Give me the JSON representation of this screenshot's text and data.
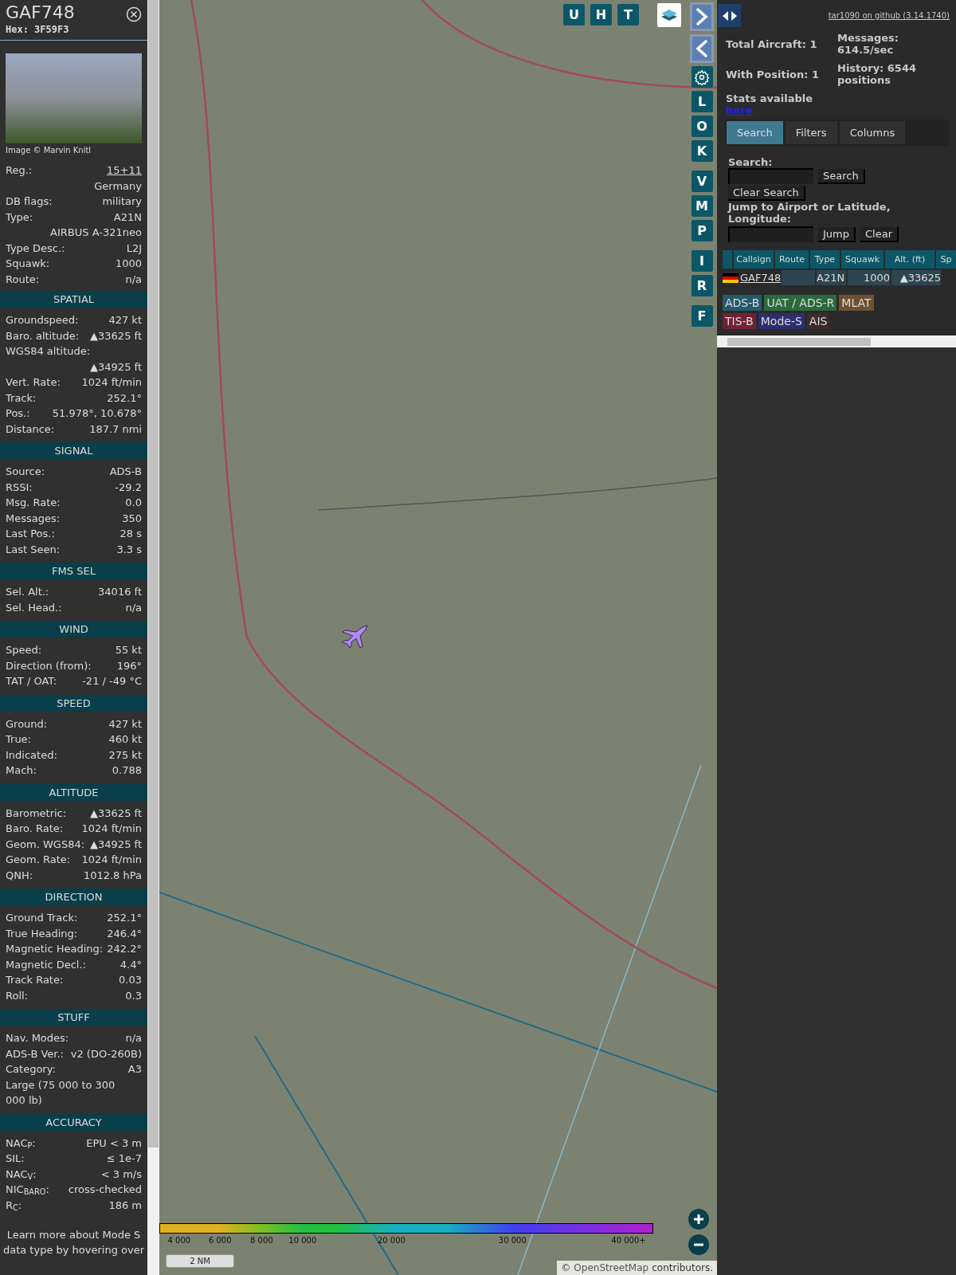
{
  "sidebar": {
    "callsign": "GAF748",
    "hex": "Hex: 3F59F3",
    "photo_credit": "Image © Marvin Knitl",
    "rows": [
      {
        "kind": "pair",
        "label": "Reg.:",
        "value": "15+11",
        "link": true
      },
      {
        "kind": "value",
        "value": "Germany"
      },
      {
        "kind": "pair",
        "label": "DB flags:",
        "value": "military"
      },
      {
        "kind": "pair",
        "label": "Type:",
        "value": "A21N"
      },
      {
        "kind": "value",
        "value": "AIRBUS A-321neo"
      },
      {
        "kind": "pair",
        "label": "Type Desc.:",
        "value": "L2J"
      },
      {
        "kind": "pair",
        "label": "Squawk:",
        "value": "1000"
      },
      {
        "kind": "pair",
        "label": "Route:",
        "value": "n/a"
      }
    ],
    "sections": [
      {
        "title": "SPATIAL",
        "rows": [
          {
            "kind": "pair",
            "label": "Groundspeed:",
            "value": "427 kt"
          },
          {
            "kind": "pair",
            "label": "Baro. altitude:",
            "value": "▲33625 ft"
          },
          {
            "kind": "label",
            "label": "WGS84 altitude:"
          },
          {
            "kind": "value",
            "value": "▲34925 ft"
          },
          {
            "kind": "pair",
            "label": "Vert. Rate:",
            "value": "1024 ft/min"
          },
          {
            "kind": "pair",
            "label": "Track:",
            "value": "252.1°"
          },
          {
            "kind": "pair",
            "label": "Pos.:",
            "value": "51.978°, 10.678°"
          },
          {
            "kind": "pair",
            "label": "Distance:",
            "value": "187.7 nmi"
          }
        ]
      },
      {
        "title": "SIGNAL",
        "rows": [
          {
            "kind": "pair",
            "label": "Source:",
            "value": "ADS-B"
          },
          {
            "kind": "pair",
            "label": "RSSI:",
            "value": "-29.2"
          },
          {
            "kind": "pair",
            "label": "Msg. Rate:",
            "value": "0.0"
          },
          {
            "kind": "pair",
            "label": "Messages:",
            "value": "350"
          },
          {
            "kind": "pair",
            "label": "Last Pos.:",
            "value": "28 s"
          },
          {
            "kind": "pair",
            "label": "Last Seen:",
            "value": "3.3 s"
          }
        ]
      },
      {
        "title": "FMS SEL",
        "rows": [
          {
            "kind": "pair",
            "label": "Sel. Alt.:",
            "value": "34016 ft"
          },
          {
            "kind": "pair",
            "label": "Sel. Head.:",
            "value": "n/a"
          }
        ]
      },
      {
        "title": "WIND",
        "rows": [
          {
            "kind": "pair",
            "label": "Speed:",
            "value": "55 kt"
          },
          {
            "kind": "pair",
            "label": "Direction (from):",
            "value": "196°"
          },
          {
            "kind": "pair",
            "label": "TAT / OAT:",
            "value": "-21 / -49 °C"
          }
        ]
      },
      {
        "title": "SPEED",
        "rows": [
          {
            "kind": "pair",
            "label": "Ground:",
            "value": "427 kt"
          },
          {
            "kind": "pair",
            "label": "True:",
            "value": "460 kt"
          },
          {
            "kind": "pair",
            "label": "Indicated:",
            "value": "275 kt"
          },
          {
            "kind": "pair",
            "label": "Mach:",
            "value": "0.788"
          }
        ]
      },
      {
        "title": "ALTITUDE",
        "rows": [
          {
            "kind": "pair",
            "label": "Barometric:",
            "value": "▲33625 ft"
          },
          {
            "kind": "pair",
            "label": "Baro. Rate:",
            "value": "1024 ft/min"
          },
          {
            "kind": "pair",
            "label": "Geom. WGS84:",
            "value": "▲34925 ft"
          },
          {
            "kind": "pair",
            "label": "Geom. Rate:",
            "value": "1024 ft/min"
          },
          {
            "kind": "pair",
            "label": "QNH:",
            "value": "1012.8 hPa"
          }
        ]
      },
      {
        "title": "DIRECTION",
        "rows": [
          {
            "kind": "pair",
            "label": "Ground Track:",
            "value": "252.1°"
          },
          {
            "kind": "pair",
            "label": "True Heading:",
            "value": "246.4°"
          },
          {
            "kind": "pair",
            "label": "Magnetic Heading:",
            "value": "242.2°"
          },
          {
            "kind": "pair",
            "label": "Magnetic Decl.:",
            "value": "4.4°"
          },
          {
            "kind": "pair",
            "label": "Track Rate:",
            "value": "0.03"
          },
          {
            "kind": "pair",
            "label": "Roll:",
            "value": "0.3"
          }
        ]
      },
      {
        "title": "STUFF",
        "rows": [
          {
            "kind": "pair",
            "label": "Nav. Modes:",
            "value": "n/a"
          },
          {
            "kind": "pair",
            "label": "ADS-B Ver.:",
            "value": "v2 (DO-260B)"
          },
          {
            "kind": "pair",
            "label": "Category:",
            "value": "A3"
          },
          {
            "kind": "label",
            "label": "Large (75 000 to 300 000 lb)"
          }
        ]
      },
      {
        "title": "ACCURACY",
        "rows": [
          {
            "kind": "pair",
            "label": "NAC$_{P}$:",
            "value": "EPU < 3 m"
          },
          {
            "kind": "pair",
            "label": "SIL:",
            "value": "≤ 1e-7"
          },
          {
            "kind": "pair",
            "label": "NAC$_{V}$:",
            "value": "< 3 m/s"
          },
          {
            "kind": "pair",
            "label": "NIC$_{BARO}$:",
            "value": "cross-checked"
          },
          {
            "kind": "pair",
            "label": "R$_{C}$:",
            "value": "186 m"
          }
        ]
      }
    ],
    "footer": "Learn more about Mode S data type by hovering over"
  },
  "map": {
    "top_buttons": [
      "U",
      "H",
      "T"
    ],
    "side_buttons": [
      {
        "kind": "next"
      },
      {
        "kind": "prev"
      },
      {
        "kind": "settings"
      },
      {
        "kind": "letter",
        "label": "L"
      },
      {
        "kind": "letter",
        "label": "O"
      },
      {
        "kind": "letter",
        "label": "K"
      },
      {
        "kind": "letter",
        "label": "V"
      },
      {
        "kind": "letter",
        "label": "M"
      },
      {
        "kind": "letter",
        "label": "P"
      },
      {
        "kind": "letter",
        "label": "I"
      },
      {
        "kind": "letter",
        "label": "R"
      },
      {
        "kind": "letter",
        "label": "F"
      }
    ],
    "altitude_legend": [
      "4 000",
      "6 000",
      "8 000",
      "10 000",
      "20 000",
      "30 000",
      "40 000+"
    ],
    "scale": "2 NM",
    "attribution_prefix": "©",
    "attribution_link": "OpenStreetMap",
    "attribution_suffix": "contributors."
  },
  "panel": {
    "version_link": "tar1090 on github (3.14.1740)",
    "stats": {
      "total": "Total Aircraft: 1",
      "messages": "Messages: 614.5/sec",
      "with_position": "With Position: 1",
      "history": "History: 6544 positions",
      "stats_text": "Stats available",
      "stats_link": "here"
    },
    "tabs": [
      {
        "label": "Search",
        "selected": true
      },
      {
        "label": "Filters",
        "selected": false
      },
      {
        "label": "Columns",
        "selected": false
      }
    ],
    "search_label": "Search:",
    "search_button": "Search",
    "clear_search_button": "Clear Search",
    "jump_label": "Jump to Airport or Latitude, Longitude:",
    "jump_button": "Jump",
    "clear_button": "Clear",
    "table": {
      "columns": [
        "Callsign",
        "Route",
        "Type",
        "Squawk",
        "Alt. (ft)",
        "Sp"
      ],
      "rows": [
        {
          "callsign": "GAF748",
          "type": "A21N",
          "squawk": "1000",
          "altitude": "▲33625"
        }
      ]
    },
    "legend": [
      {
        "label": "ADS-B",
        "color": "#255a6b"
      },
      {
        "label": "UAT / ADS-R",
        "color": "#2a6a3c"
      },
      {
        "label": "MLAT",
        "color": "#6e5230"
      },
      {
        "label": "TIS-B",
        "color": "#6e2234"
      },
      {
        "label": "Mode-S",
        "color": "#2d2e6e"
      },
      {
        "label": "AIS",
        "color": "#3b2b2b"
      }
    ]
  }
}
